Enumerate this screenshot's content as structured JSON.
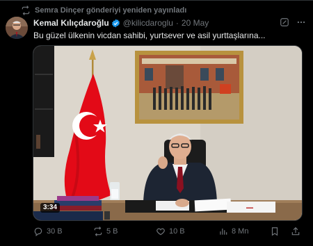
{
  "repost": {
    "label": "Semra Dinçer gönderiyi yeniden yayınladı",
    "icon": "repost-icon"
  },
  "author": {
    "name": "Kemal Kılıçdaroğlu",
    "handle": "@kilicdaroglu",
    "date": "20 May",
    "verified_color": "#1d9bf0"
  },
  "tweet": {
    "text": "Bu güzel ülkenin vicdan sahibi, yurtsever ve asil yurttaşlarına..."
  },
  "media": {
    "duration": "3:34"
  },
  "actions": {
    "replies": "30 B",
    "reposts": "5 B",
    "likes": "10 B",
    "views": "8 Mn"
  },
  "colors": {
    "background": "#000000",
    "text": "#e7e9ea",
    "muted": "#71767b",
    "border": "#2f3336",
    "flag_red": "#e30a17"
  }
}
